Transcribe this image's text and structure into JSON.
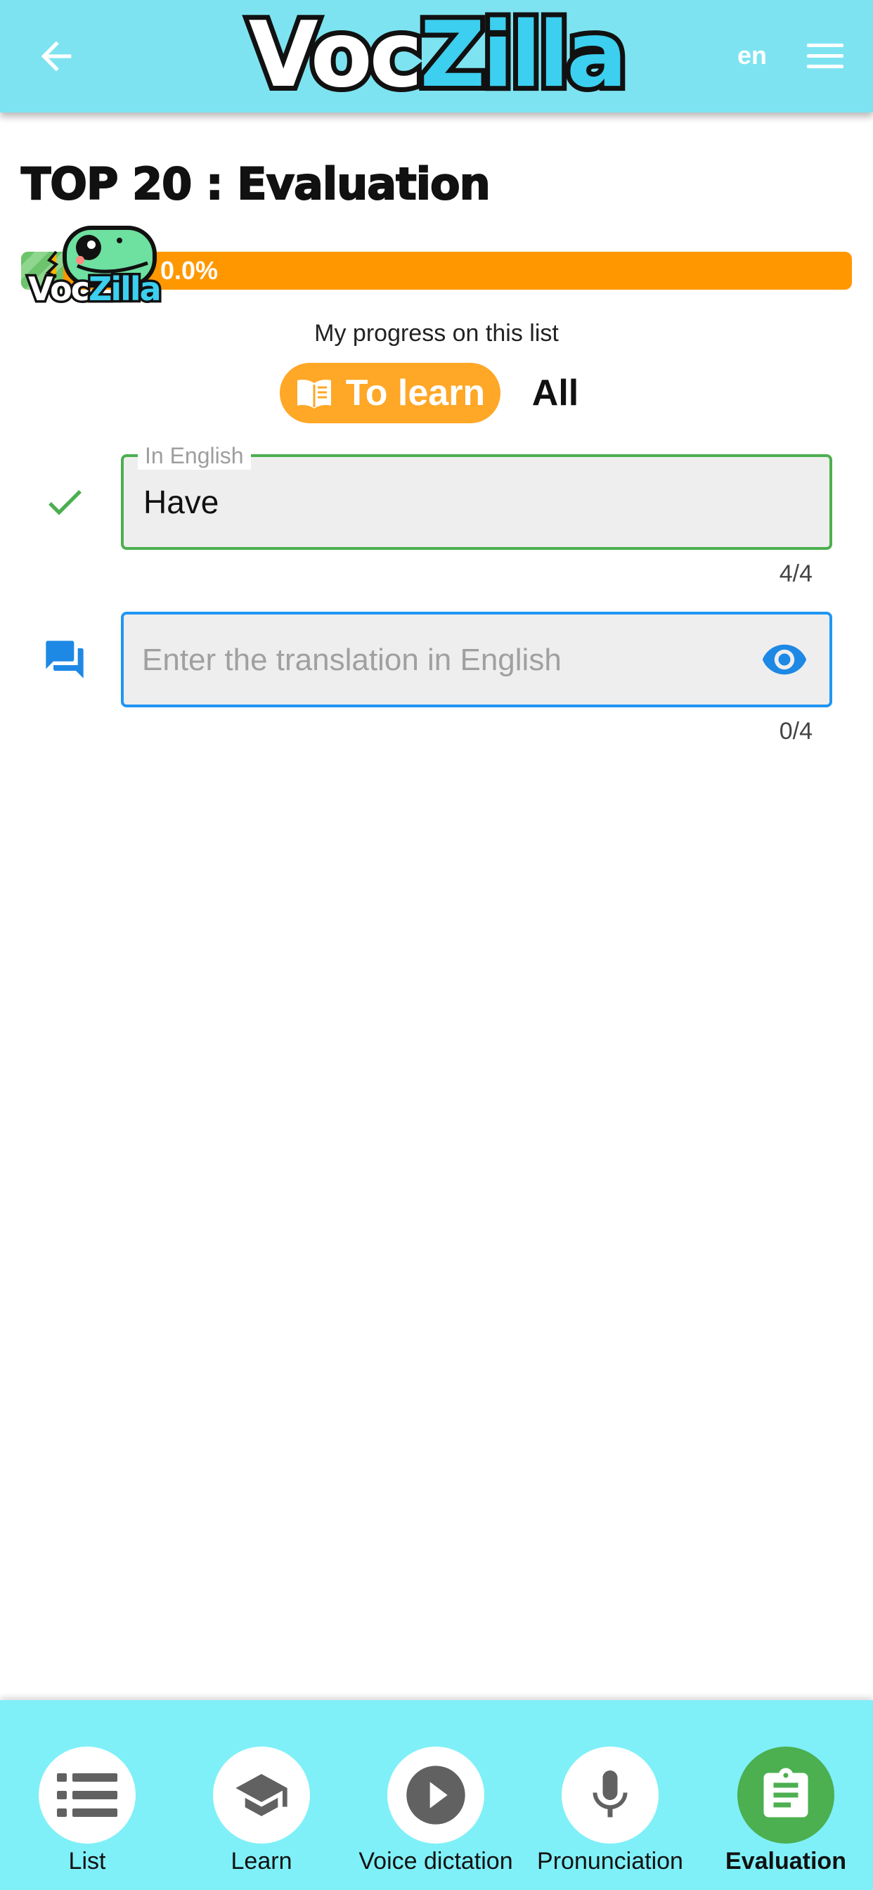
{
  "header": {
    "logo_part1": "Voc",
    "logo_part2": "Zilla",
    "language": "en",
    "bar_color": "#7ee3f1"
  },
  "page": {
    "title": "TOP 20 : Evaluation"
  },
  "progress": {
    "percent": 0.0,
    "label": "0.0%",
    "caption": "My progress on this list",
    "mascot_part1": "Voc",
    "mascot_part2": "Zilla"
  },
  "filter": {
    "to_learn_label": "To learn",
    "all_label": "All",
    "selected": "To learn"
  },
  "fields": [
    {
      "status_icon": "check-icon",
      "label": "In English",
      "value": "Have",
      "counter": "4/4",
      "border_color": "#4caf50"
    },
    {
      "status_icon": "chat-bubbles-icon",
      "placeholder": "Enter the translation in English",
      "value": "",
      "counter": "0/4",
      "border_color": "#2196f3",
      "action_icon": "eye-icon"
    }
  ],
  "bottom_nav": {
    "items": [
      {
        "label": "List",
        "icon": "list-icon"
      },
      {
        "label": "Learn",
        "icon": "graduation-cap-icon"
      },
      {
        "label": "Voice dictation",
        "icon": "play-icon"
      },
      {
        "label": "Pronunciation",
        "icon": "microphone-icon"
      },
      {
        "label": "Evaluation",
        "icon": "clipboard-icon"
      }
    ],
    "active": "Evaluation",
    "active_color": "#4caf50"
  }
}
